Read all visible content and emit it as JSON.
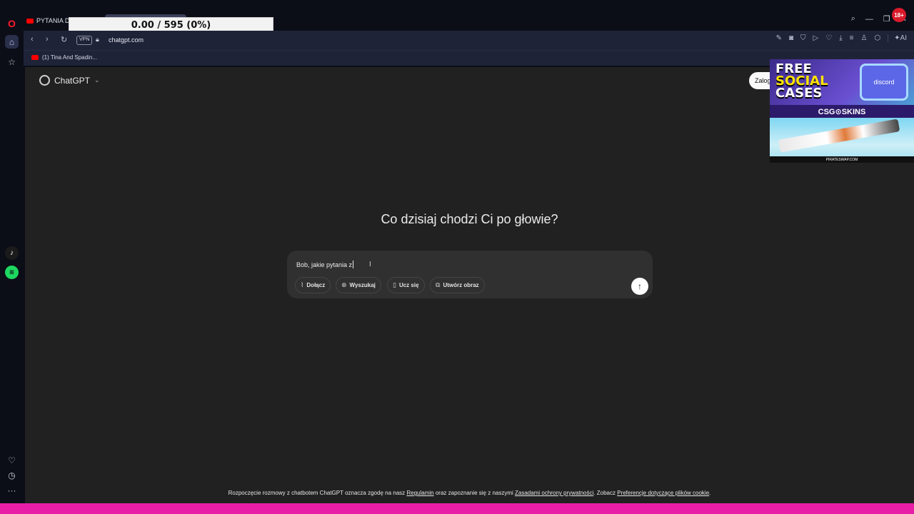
{
  "overlay": {
    "counter": "0.00 / 595 (0%)"
  },
  "browser": {
    "tab_title": "PYTANIA DO",
    "url": "chatgpt.com",
    "vpn_label": "VPN",
    "ai_label": "AI",
    "age_badge": "18+",
    "bookmark": "(1) Tina And Spadin..."
  },
  "page": {
    "brand": "ChatGPT",
    "login_label": "Zalog",
    "headline": "Co dzisiaj chodzi Ci po głowie?",
    "composer": {
      "typed_text": "Bob, jakie pytania z",
      "chips": [
        "Dołącz",
        "Wyszukaj",
        "Ucz się",
        "Utwórz obraz"
      ]
    },
    "footer": {
      "t1": "Rozpoczęcie rozmowy z chatbotem ChatGPT oznacza zgodę na nasz ",
      "l1": "Regulamin",
      "t2": " oraz zapoznanie się z naszymi ",
      "l2": "Zasadami ochrony prywatności",
      "t3": ". Zobacz ",
      "l3": "Preferencje dotyczące plików cookie",
      "t4": "."
    }
  },
  "ad": {
    "free": "FREE",
    "social": "SOCIAL",
    "cases": "CASES",
    "discord": "discord",
    "brand": "CSG⊙SKINS",
    "url": "PIRATESWAP.COM"
  },
  "colors": {
    "accent_pink": "#e81fa6",
    "page_bg": "#212121",
    "composer_bg": "#303030"
  }
}
